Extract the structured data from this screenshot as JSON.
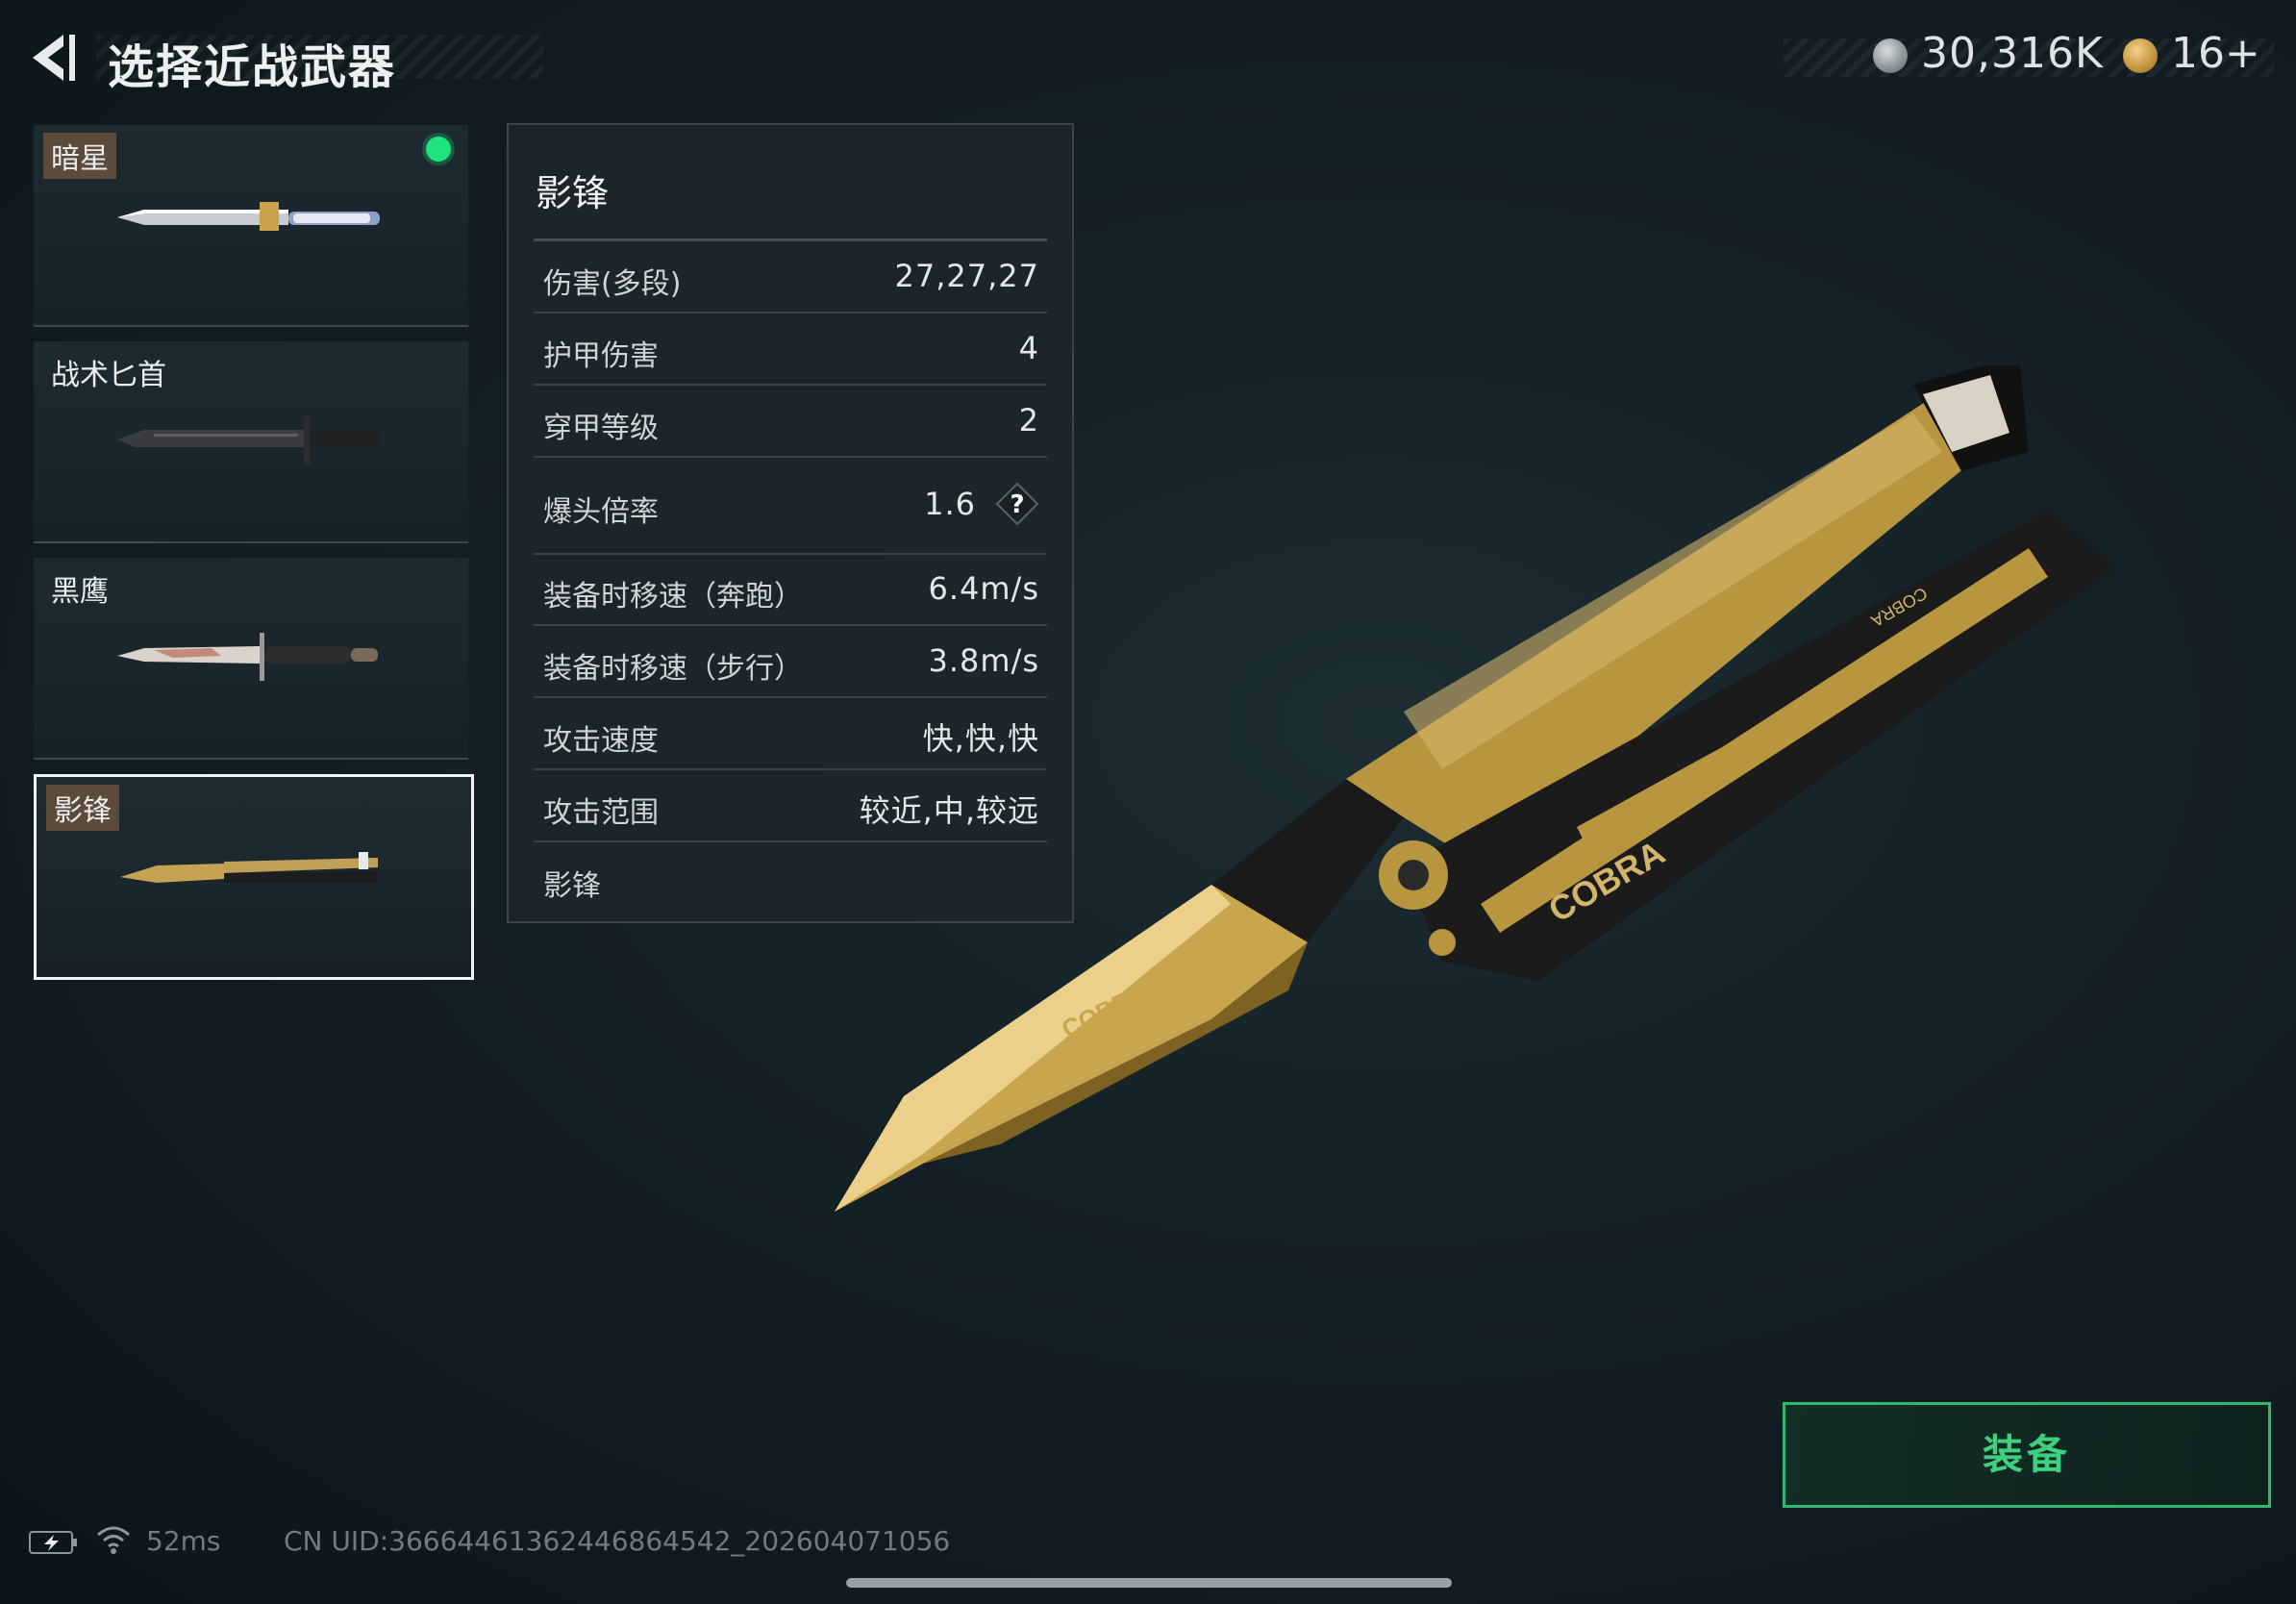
{
  "header": {
    "title": "选择近战武器",
    "currency1_value": "30,316K",
    "currency2_value": "16+"
  },
  "weapons": [
    {
      "name": "暗星",
      "equipped": true
    },
    {
      "name": "战术匕首"
    },
    {
      "name": "黑鹰"
    },
    {
      "name": "影锋",
      "selected": true
    }
  ],
  "stats": {
    "title": "影锋",
    "rows": [
      {
        "label": "伤害(多段)",
        "value": "27,27,27"
      },
      {
        "label": "护甲伤害",
        "value": "4"
      },
      {
        "label": "穿甲等级",
        "value": "2"
      },
      {
        "label": "爆头倍率",
        "value": "1.6"
      },
      {
        "label": "装备时移速（奔跑）",
        "value": "6.4m/s"
      },
      {
        "label": "装备时移速（步行）",
        "value": "3.8m/s"
      },
      {
        "label": "攻击速度",
        "value": "快,快,快"
      },
      {
        "label": "攻击范围",
        "value": "较近,中,较远"
      }
    ],
    "help_symbol": "?",
    "footer": "影锋"
  },
  "weapon_branding": [
    "COBRA",
    "COBRA",
    "COBRA"
  ],
  "equip_button": {
    "label": "装备"
  },
  "status_bar": {
    "ping": "52ms",
    "uid": "CN UID:3666446136244686454​2_202604071056"
  },
  "colors": {
    "accent_green": "#3fd07f",
    "equipped_dot": "#1ee37f",
    "gold": "#b8963f"
  }
}
